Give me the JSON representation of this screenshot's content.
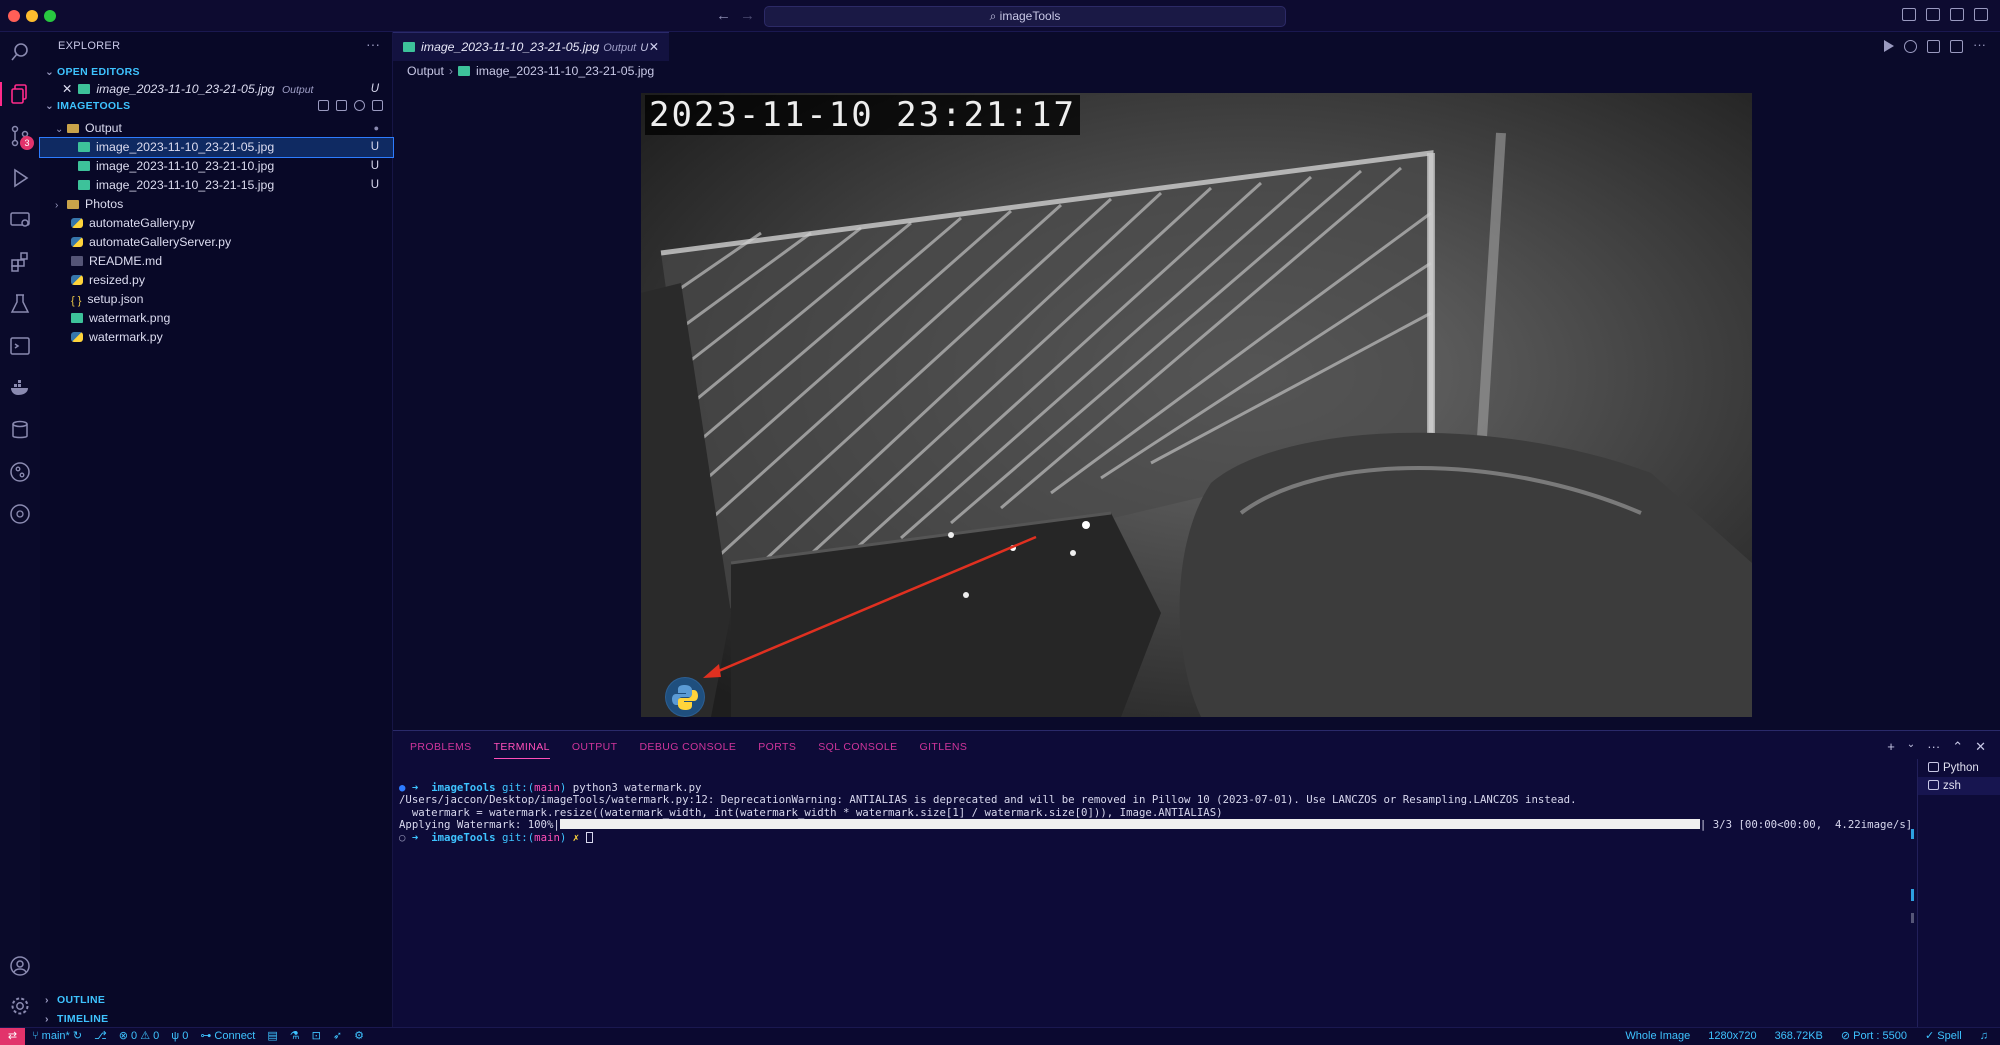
{
  "window": {
    "search_text": "⌕ imageTools"
  },
  "sidebar": {
    "title": "EXPLORER",
    "open_editors_title": "OPEN EDITORS",
    "open_editor": {
      "name": "image_2023-11-10_23-21-05.jpg",
      "desc": "Output",
      "status": "U"
    },
    "project_title": "IMAGETOOLS",
    "tree": [
      {
        "name": "Output",
        "type": "folder",
        "expanded": true,
        "status": ""
      },
      {
        "name": "image_2023-11-10_23-21-05.jpg",
        "type": "img",
        "status": "U",
        "selected": true
      },
      {
        "name": "image_2023-11-10_23-21-10.jpg",
        "type": "img",
        "status": "U"
      },
      {
        "name": "image_2023-11-10_23-21-15.jpg",
        "type": "img",
        "status": "U"
      },
      {
        "name": "Photos",
        "type": "folder",
        "expanded": false,
        "status": ""
      },
      {
        "name": "automateGallery.py",
        "type": "py"
      },
      {
        "name": "automateGalleryServer.py",
        "type": "py"
      },
      {
        "name": "README.md",
        "type": "md"
      },
      {
        "name": "resized.py",
        "type": "py"
      },
      {
        "name": "setup.json",
        "type": "json"
      },
      {
        "name": "watermark.png",
        "type": "img"
      },
      {
        "name": "watermark.py",
        "type": "py"
      }
    ],
    "outline_title": "OUTLINE",
    "timeline_title": "TIMELINE",
    "scm_badge": "3"
  },
  "editor": {
    "tab": {
      "name": "image_2023-11-10_23-21-05.jpg",
      "desc": "Output",
      "status": "U"
    },
    "breadcrumb": [
      "Output",
      "image_2023-11-10_23-21-05.jpg"
    ],
    "image_timestamp": "2023-11-10  23:21:17"
  },
  "panel": {
    "tabs": [
      "PROBLEMS",
      "TERMINAL",
      "OUTPUT",
      "DEBUG CONSOLE",
      "PORTS",
      "SQL CONSOLE",
      "GITLENS"
    ],
    "active_tab": "TERMINAL",
    "terminal": {
      "prompt_dir": "imageTools",
      "git_label": "git:(",
      "branch": "main",
      "git_close": ")",
      "command": "python3 watermark.py",
      "warning_line": "/Users/jaccon/Desktop/imageTools/watermark.py:12: DeprecationWarning: ANTIALIAS is deprecated and will be removed in Pillow 10 (2023-07-01). Use LANCZOS or Resampling.LANCZOS instead.",
      "code_line": "  watermark = watermark.resize((watermark_width, int(watermark_width * watermark.size[1] / watermark.size[0])), Image.ANTIALIAS)",
      "progress_label": "Applying Watermark: 100%|",
      "progress_fraction": 1.0,
      "progress_stats": "| 3/3 [00:00<00:00,  4.22image/s]",
      "dirty_marker": "✗"
    },
    "terminals": [
      "Python",
      "zsh"
    ]
  },
  "statusbar": {
    "branch": "main*",
    "errors": "0",
    "warnings": "0",
    "ports": "0",
    "connect": "Connect",
    "whole_image": "Whole Image",
    "dimensions": "1280x720",
    "filesize": "368.72KB",
    "port": "Port : 5500",
    "spell": "Spell"
  }
}
